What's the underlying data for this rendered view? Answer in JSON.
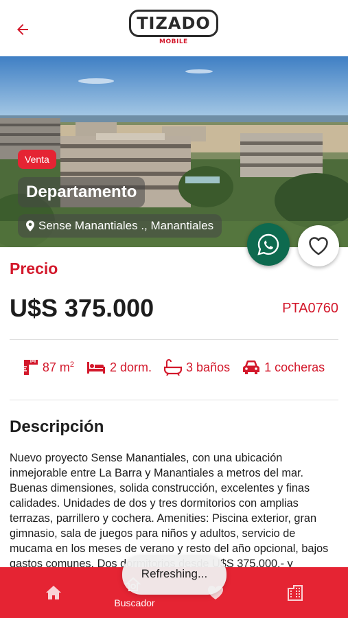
{
  "header": {
    "logo_text": "TIZADO",
    "logo_subtext": "MOBILE"
  },
  "listing": {
    "operation_badge": "Venta",
    "property_type": "Departamento",
    "location": "Sense Manantiales ., Manantiales",
    "price_label": "Precio",
    "price": "U$S 375.000",
    "reference_code": "PTA0760"
  },
  "features": {
    "area_value": "87 m",
    "area_unit_exp": "2",
    "bedrooms": "2 dorm.",
    "bathrooms": "3 baños",
    "garages": "1 cocheras"
  },
  "description": {
    "title": "Descripción",
    "text": "Nuevo proyecto Sense Manantiales, con una ubicación inmejorable entre La Barra y Manantiales a metros del mar. Buenas dimensiones, solida construcción, excelentes y finas calidades. Unidades de dos y tres dormitorios con amplias terrazas, parrillero y cochera. Amenities: Piscina exterior, gran gimnasio, sala de juegos para niños y adultos, servicio de mucama en los meses de verano y resto del año opcional, bajos gastos comunes. Dos dormitorios desde U$S 375.000.- y"
  },
  "toast": {
    "text": "Refreshing..."
  },
  "bottom_nav": {
    "search_label": "Buscador"
  },
  "colors": {
    "accent": "#d3182b",
    "nav_bg": "#e52433",
    "whatsapp": "#0e6a4f"
  },
  "icons": [
    "back-arrow-icon",
    "location-pin-icon",
    "whatsapp-icon",
    "heart-icon",
    "ruler-icon",
    "bed-icon",
    "bathtub-icon",
    "car-icon",
    "home-icon",
    "search-house-icon",
    "favorites-icon",
    "building-icon"
  ]
}
